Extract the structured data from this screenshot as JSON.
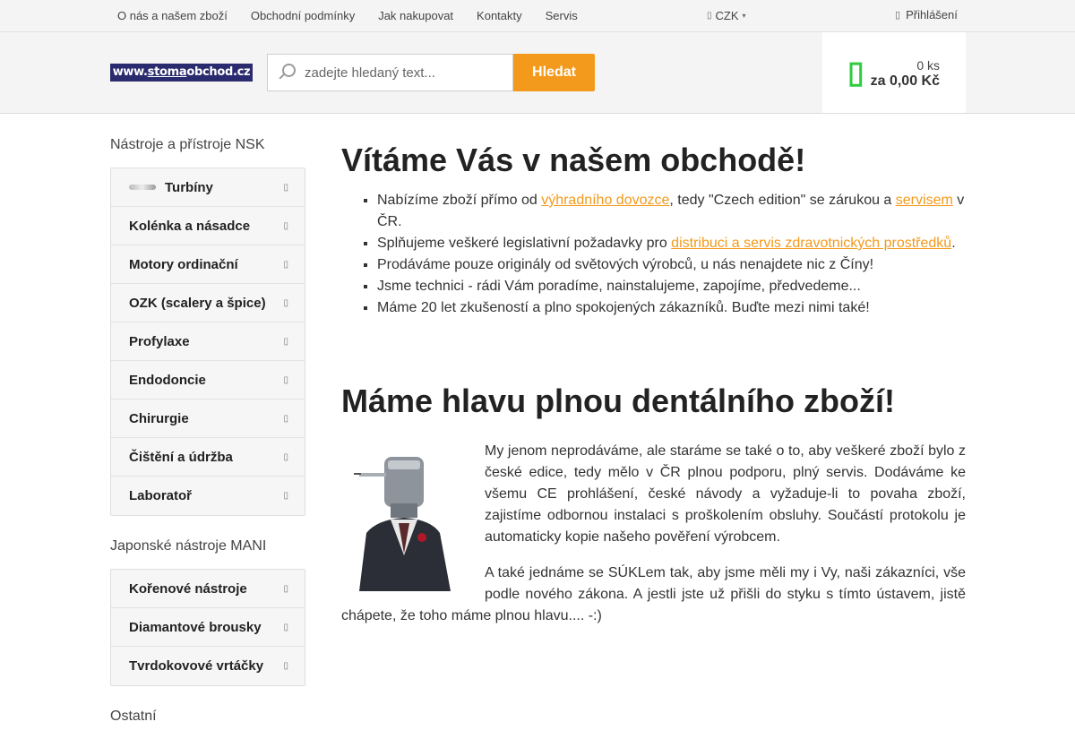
{
  "topnav": {
    "items": [
      "O nás a našem zboží",
      "Obchodní podmínky",
      "Jak nakupovat",
      "Kontakty",
      "Servis"
    ],
    "currency": "CZK",
    "login": "Přihlášení"
  },
  "header": {
    "logo_a": "www.",
    "logo_b": "stoma",
    "logo_c": "obchod.cz",
    "search_placeholder": "zadejte hledaný text...",
    "search_button": "Hledat",
    "cart_qty": "0 ks",
    "cart_sum": "za 0,00 Kč",
    "cart_icon": "shopping-bag-icon"
  },
  "sidebar": {
    "section1_title": "Nástroje a přístroje NSK",
    "section1_items": [
      "Turbíny",
      "Kolénka a násadce",
      "Motory ordinační",
      "OZK (scalery a špice)",
      "Profylaxe",
      "Endodoncie",
      "Chirurgie",
      "Čištění a údržba",
      "Laboratoř"
    ],
    "section2_title": "Japonské nástroje MANI",
    "section2_items": [
      "Kořenové nástroje",
      "Diamantové brousky",
      "Tvrdokovové vrtáčky"
    ],
    "section3_title": "Ostatní"
  },
  "main": {
    "welcome_title": "Vítáme Vás v našem obchodě!",
    "bullet1_a": "Nabízíme zboží přímo od ",
    "bullet1_link1": "výhradního dovozce",
    "bullet1_b": ", tedy \"Czech edition\" se zárukou a ",
    "bullet1_link2": "servisem",
    "bullet1_c": " v ČR.",
    "bullet2_a": "Splňujeme veškeré legislativní požadavky pro ",
    "bullet2_link": "distribuci a servis zdravotnických prostředků",
    "bullet2_b": ".",
    "bullet3": "Prodáváme pouze originály od světových výrobců, u nás nenajdete nic z Číny!",
    "bullet4": "Jsme technici - rádi Vám poradíme, nainstalujeme, zapojíme, předvedeme...",
    "bullet5": "Máme 20 let zkušeností a plno spokojených zákazníků. Buďte mezi nimi také!",
    "head_title": "Máme hlavu plnou dentálního zboží!",
    "para1": "My jenom neprodáváme, ale staráme se také o to, aby veškeré zboží bylo z české edice, tedy mělo v ČR plnou podporu, plný servis. Dodáváme ke všemu CE prohlášení, české návody a vyžaduje-li to povaha zboží, zajistíme odbornou instalaci s proškolením obsluhy. Součástí protokolu je automaticky kopie našeho pověření výrobcem.",
    "para2": "A také jednáme se SÚKLem tak, aby jsme měli my i Vy, naši zákazníci, vše podle nového zákona. A jestli jste už přišli do styku s tímto ústavem, jistě chápete, že toho máme plnou hlavu.... -:)"
  },
  "colors": {
    "accent": "#f39a1c",
    "cart_icon": "#2ecc40",
    "logo_bg": "#2a2a6e"
  }
}
